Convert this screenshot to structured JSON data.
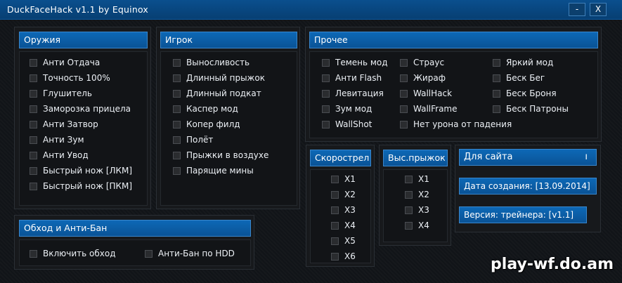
{
  "window": {
    "title": "DuckFaceHack v1.1 by Equinox",
    "minimize_label": "-",
    "close_label": "X"
  },
  "weapons": {
    "title": "Оружия",
    "items": [
      "Анти Отдача",
      "Точность 100%",
      "Глушитель",
      "Заморозка прицела",
      "Анти Затвор",
      "Анти Зум",
      "Анти Увод",
      "Быстрый нож [ЛКМ]",
      "Быстрый нож [ПКМ]"
    ]
  },
  "player": {
    "title": "Игрок",
    "items": [
      "Выносливость",
      "Длинный прыжок",
      "Длинный подкат",
      "Каспер мод",
      "Копер филд",
      "Полёт",
      "Прыжки в воздухе",
      "Парящие мины"
    ]
  },
  "other": {
    "title": "Прочее",
    "col1": [
      "Темень мод",
      "Анти Flash",
      "Левитация",
      "Зум мод",
      "WallShot"
    ],
    "col2": [
      "Страус",
      "Жираф",
      "WallHack",
      "WallFrame",
      "Нет урона от падения"
    ],
    "col3": [
      "Яркий мод",
      "Беск Бег",
      "Беск Броня",
      "Беск Патроны"
    ]
  },
  "bypass": {
    "title": "Обход и Анти-Бан",
    "items": [
      "Включить обход",
      "Анти-Бан по HDD"
    ]
  },
  "rate_of_fire": {
    "title": "Скорострел",
    "items": [
      "X1",
      "X2",
      "X3",
      "X4",
      "X5",
      "X6"
    ]
  },
  "high_jump": {
    "title": "Выс.прыжок",
    "items": [
      "X1",
      "X2",
      "X3",
      "X4"
    ]
  },
  "info": {
    "site_label": "Для сайта",
    "site_mark": "ı",
    "created_label": "Дата создания: [13.09.2014]",
    "version_label": "Версия: трейнера: [v1.1]"
  },
  "watermark": "play-wf.do.am"
}
